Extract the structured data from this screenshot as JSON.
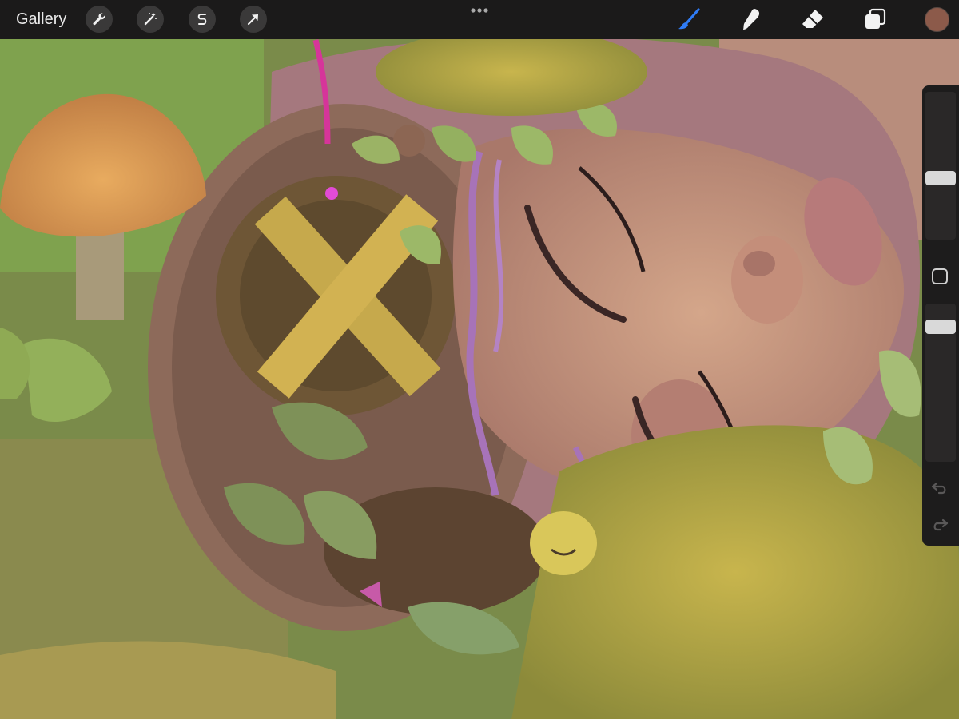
{
  "toolbar": {
    "gallery_label": "Gallery",
    "left_tools": [
      {
        "name": "actions",
        "icon": "wrench-icon"
      },
      {
        "name": "adjustments",
        "icon": "magic-wand-icon"
      },
      {
        "name": "selection",
        "icon": "selection-s-icon"
      },
      {
        "name": "transform",
        "icon": "arrow-cursor-icon"
      }
    ],
    "more_icon": "more-dots-icon",
    "right_tools": [
      {
        "name": "brush",
        "icon": "brush-icon",
        "active": true,
        "active_color": "#2f7cf6"
      },
      {
        "name": "smudge",
        "icon": "smudge-finger-icon",
        "active": false
      },
      {
        "name": "eraser",
        "icon": "eraser-icon",
        "active": false
      },
      {
        "name": "layers",
        "icon": "layers-icon",
        "active": false
      }
    ],
    "current_color": "#8c5a4a"
  },
  "sidebar": {
    "brush_size": 0.41,
    "brush_opacity": 0.89,
    "modify_icon": "square-modify-icon",
    "undo_icon": "undo-arrow-icon",
    "redo_icon": "redo-arrow-icon"
  },
  "canvas": {
    "subject": "painting",
    "palette": {
      "background_green": "#7d9a4a",
      "skin": "#c99a80",
      "moss": "#b0a443",
      "mushroom": "#d99d55",
      "hair": "#a773b8",
      "planks": "#c6a94c"
    }
  }
}
